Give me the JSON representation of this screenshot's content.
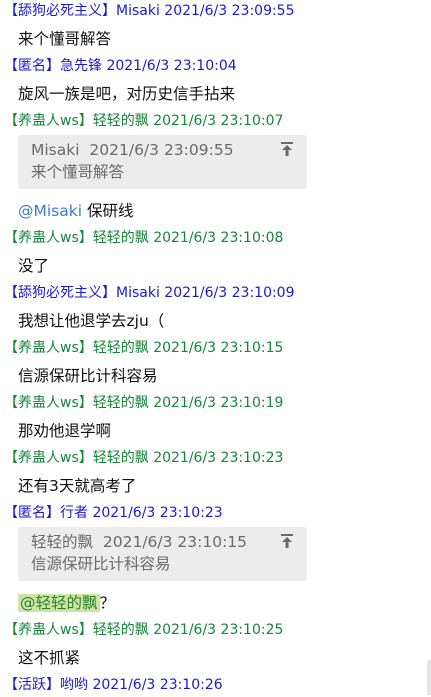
{
  "colors": {
    "blue": "#1a1ad6",
    "green": "#15873a",
    "quote_bg": "#ececec",
    "mention_highlight": "#cbe6a3"
  },
  "icons": {
    "quote_jump": "arrow-up-to-top-icon"
  },
  "messages": [
    {
      "color": "blue",
      "tag": "【舔狗必死主义】",
      "nick": "Misaki",
      "time": "2021/6/3 23:09:55",
      "lines": [
        "来个懂哥解答"
      ]
    },
    {
      "color": "blue",
      "tag": "【匿名】",
      "nick": "急先锋",
      "time": "2021/6/3 23:10:04",
      "lines": [
        "旋风一族是吧，对历史信手拈来"
      ]
    },
    {
      "color": "green",
      "tag": "【养蛊人ws】",
      "nick": "轻轻的飘",
      "time": "2021/6/3 23:10:07",
      "quote": {
        "nick": "Misaki",
        "time": "2021/6/3 23:09:55",
        "text": "来个懂哥解答"
      },
      "mention": "@Misaki",
      "after_mention": " 保研线"
    },
    {
      "color": "green",
      "tag": "【养蛊人ws】",
      "nick": "轻轻的飘",
      "time": "2021/6/3 23:10:08",
      "lines": [
        "没了"
      ]
    },
    {
      "color": "blue",
      "tag": "【舔狗必死主义】",
      "nick": "Misaki",
      "time": "2021/6/3 23:10:09",
      "lines": [
        "我想让他退学去zju（"
      ]
    },
    {
      "color": "green",
      "tag": "【养蛊人ws】",
      "nick": "轻轻的飘",
      "time": "2021/6/3 23:10:15",
      "lines": [
        "信源保研比计科容易"
      ]
    },
    {
      "color": "green",
      "tag": "【养蛊人ws】",
      "nick": "轻轻的飘",
      "time": "2021/6/3 23:10:19",
      "lines": [
        "那劝他退学啊"
      ]
    },
    {
      "color": "green",
      "tag": "【养蛊人ws】",
      "nick": "轻轻的飘",
      "time": "2021/6/3 23:10:23",
      "lines": [
        "还有3天就高考了"
      ]
    },
    {
      "color": "blue",
      "tag": "【匿名】",
      "nick": "行者",
      "time": "2021/6/3 23:10:23",
      "quote": {
        "nick": "轻轻的飘",
        "time": "2021/6/3 23:10:15",
        "text": "信源保研比计科容易"
      },
      "mention": "@轻轻的飘",
      "mention_highlight": true,
      "after_mention": "？"
    },
    {
      "color": "green",
      "tag": "【养蛊人ws】",
      "nick": "轻轻的飘",
      "time": "2021/6/3 23:10:25",
      "lines": [
        "这不抓紧"
      ]
    },
    {
      "color": "blue",
      "tag": "【活跃】",
      "nick": "哟哟",
      "time": "2021/6/3 23:10:26",
      "lines": []
    }
  ]
}
